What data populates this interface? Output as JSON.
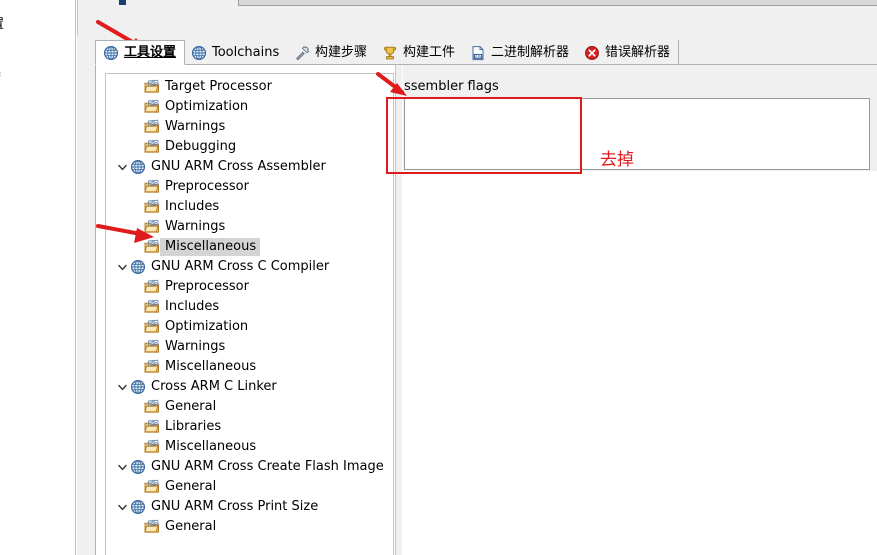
{
  "background_clipped_panel": {
    "text_fragment_1": "置",
    "text_fragment_2": "器"
  },
  "tabs": [
    {
      "label": "工具设置",
      "icon": "gear-globe-icon",
      "selected": true
    },
    {
      "label": "Toolchains",
      "icon": "gear-globe-icon",
      "selected": false
    },
    {
      "label": "构建步骤",
      "icon": "hammer-icon",
      "selected": false
    },
    {
      "label": "构建工件",
      "icon": "artifact-icon",
      "selected": false
    },
    {
      "label": "二进制解析器",
      "icon": "binary-file-icon",
      "selected": false
    },
    {
      "label": "错误解析器",
      "icon": "error-circle-icon",
      "selected": false
    }
  ],
  "tree": [
    {
      "label": "Target Processor",
      "indent": 1,
      "icon": "folder-tool-icon",
      "twisty": "",
      "selected": false
    },
    {
      "label": "Optimization",
      "indent": 1,
      "icon": "folder-tool-icon",
      "twisty": "",
      "selected": false
    },
    {
      "label": "Warnings",
      "indent": 1,
      "icon": "folder-tool-icon",
      "twisty": "",
      "selected": false
    },
    {
      "label": "Debugging",
      "indent": 1,
      "icon": "folder-tool-icon",
      "twisty": "",
      "selected": false
    },
    {
      "label": "GNU ARM Cross Assembler",
      "indent": 0,
      "icon": "gear-globe-icon",
      "twisty": "expanded",
      "selected": false
    },
    {
      "label": "Preprocessor",
      "indent": 1,
      "icon": "folder-tool-icon",
      "twisty": "",
      "selected": false
    },
    {
      "label": "Includes",
      "indent": 1,
      "icon": "folder-tool-icon",
      "twisty": "",
      "selected": false
    },
    {
      "label": "Warnings",
      "indent": 1,
      "icon": "folder-tool-icon",
      "twisty": "",
      "selected": false
    },
    {
      "label": "Miscellaneous",
      "indent": 1,
      "icon": "folder-tool-icon",
      "twisty": "",
      "selected": true
    },
    {
      "label": "GNU ARM Cross C Compiler",
      "indent": 0,
      "icon": "gear-globe-icon",
      "twisty": "expanded",
      "selected": false
    },
    {
      "label": "Preprocessor",
      "indent": 1,
      "icon": "folder-tool-icon",
      "twisty": "",
      "selected": false
    },
    {
      "label": "Includes",
      "indent": 1,
      "icon": "folder-tool-icon",
      "twisty": "",
      "selected": false
    },
    {
      "label": "Optimization",
      "indent": 1,
      "icon": "folder-tool-icon",
      "twisty": "",
      "selected": false
    },
    {
      "label": "Warnings",
      "indent": 1,
      "icon": "folder-tool-icon",
      "twisty": "",
      "selected": false
    },
    {
      "label": "Miscellaneous",
      "indent": 1,
      "icon": "folder-tool-icon",
      "twisty": "",
      "selected": false
    },
    {
      "label": "Cross ARM C Linker",
      "indent": 0,
      "icon": "gear-globe-icon",
      "twisty": "expanded",
      "selected": false
    },
    {
      "label": "General",
      "indent": 1,
      "icon": "folder-tool-icon",
      "twisty": "",
      "selected": false
    },
    {
      "label": "Libraries",
      "indent": 1,
      "icon": "folder-tool-icon",
      "twisty": "",
      "selected": false
    },
    {
      "label": "Miscellaneous",
      "indent": 1,
      "icon": "folder-tool-icon",
      "twisty": "",
      "selected": false
    },
    {
      "label": "GNU ARM Cross Create Flash Image",
      "indent": 0,
      "icon": "gear-globe-icon",
      "twisty": "expanded",
      "selected": false
    },
    {
      "label": "General",
      "indent": 1,
      "icon": "folder-tool-icon",
      "twisty": "",
      "selected": false
    },
    {
      "label": "GNU ARM Cross Print Size",
      "indent": 0,
      "icon": "gear-globe-icon",
      "twisty": "expanded",
      "selected": false
    },
    {
      "label": "General",
      "indent": 1,
      "icon": "folder-tool-icon",
      "twisty": "",
      "selected": false
    }
  ],
  "right_panel": {
    "field_label": "ssembler flags",
    "flags_value": ""
  },
  "annotations": {
    "note_text": "去掉",
    "color": "#e01b1b",
    "arrow_to_tab": "points at 工具设置 tab",
    "arrow_to_tree_item": "points at Miscellaneous",
    "arrow_to_field_label": "points at ssembler flags"
  }
}
